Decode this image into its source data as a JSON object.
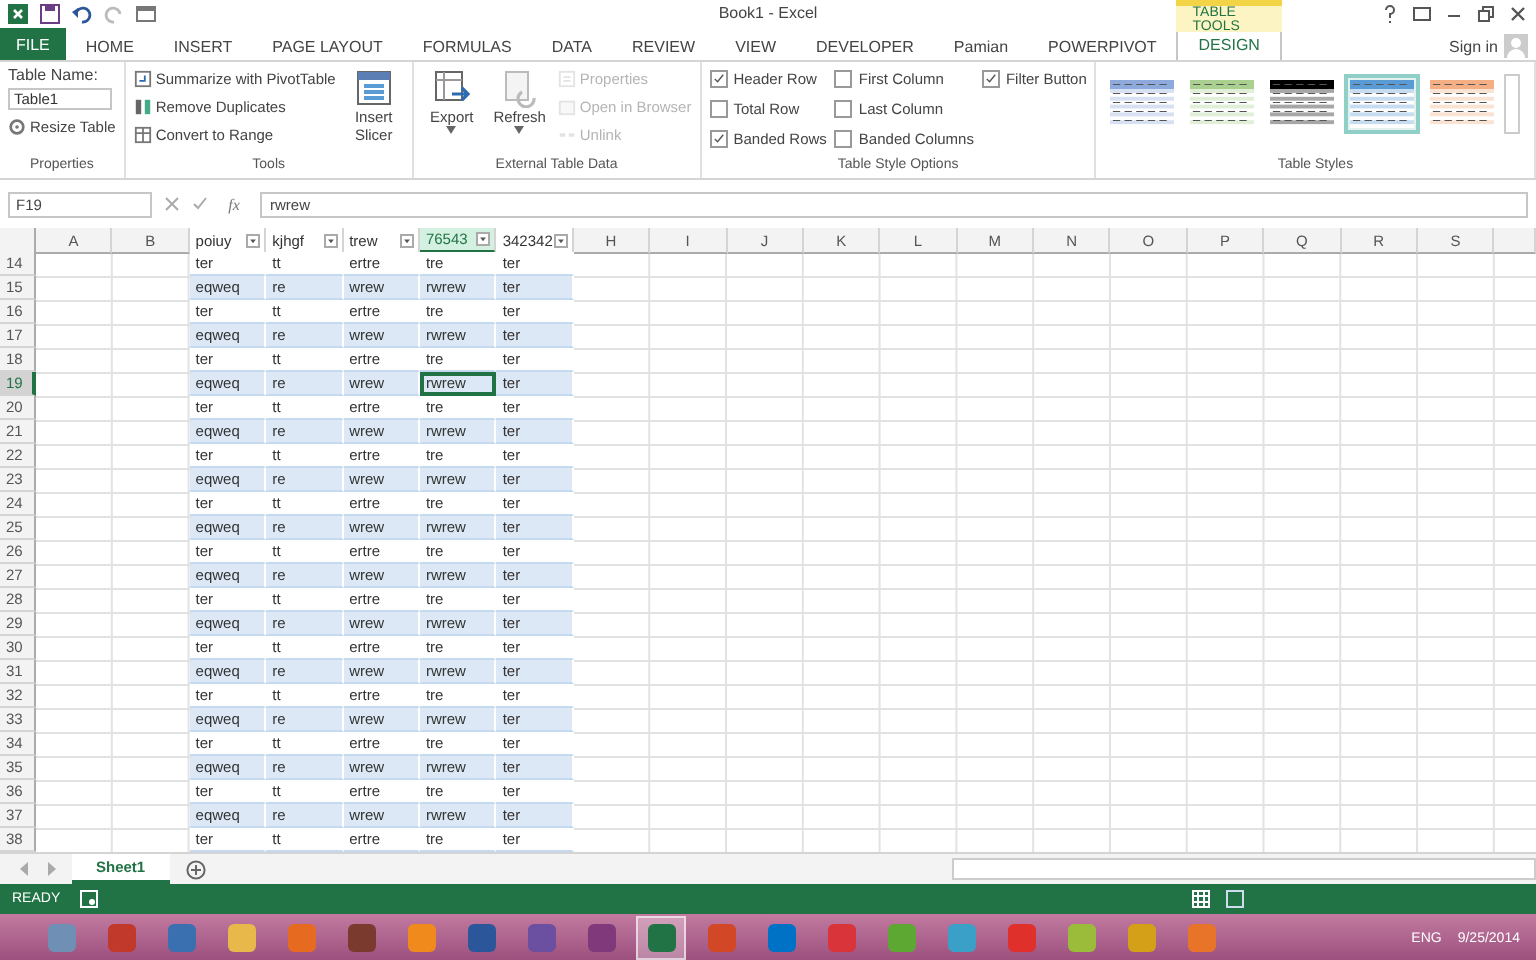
{
  "window": {
    "title": "Book1 - Excel"
  },
  "contextual_tab": {
    "label": "TABLE TOOLS"
  },
  "tabs": [
    {
      "label": "FILE",
      "kind": "file",
      "selected": false
    },
    {
      "label": "HOME",
      "kind": "tab",
      "selected": false
    },
    {
      "label": "INSERT",
      "kind": "tab",
      "selected": false
    },
    {
      "label": "PAGE LAYOUT",
      "kind": "tab",
      "selected": false
    },
    {
      "label": "FORMULAS",
      "kind": "tab",
      "selected": false
    },
    {
      "label": "DATA",
      "kind": "tab",
      "selected": false
    },
    {
      "label": "REVIEW",
      "kind": "tab",
      "selected": false
    },
    {
      "label": "VIEW",
      "kind": "tab",
      "selected": false
    },
    {
      "label": "DEVELOPER",
      "kind": "tab",
      "selected": false
    },
    {
      "label": "Pamian",
      "kind": "tab",
      "selected": false
    },
    {
      "label": "POWERPIVOT",
      "kind": "tab",
      "selected": false
    },
    {
      "label": "DESIGN",
      "kind": "tab",
      "selected": true
    }
  ],
  "account": {
    "label": "Sign in"
  },
  "ribbon_groups": [
    {
      "label": "Properties",
      "columns": [
        [
          {
            "kind": "label",
            "text": "Table Name:"
          },
          {
            "kind": "field",
            "value": "Table1"
          },
          {
            "kind": "small",
            "text": "Resize Table",
            "disabled": false
          }
        ]
      ]
    },
    {
      "label": "Tools",
      "columns": [
        [
          {
            "kind": "small",
            "text": "Summarize with PivotTable",
            "disabled": false
          },
          {
            "kind": "small",
            "text": "Remove Duplicates",
            "disabled": false
          },
          {
            "kind": "small",
            "text": "Convert to Range",
            "disabled": false
          }
        ],
        [
          {
            "kind": "large",
            "text": "Insert Slicer",
            "disabled": false,
            "has_menu": false
          }
        ]
      ]
    },
    {
      "label": "External Table Data",
      "columns": [
        [
          {
            "kind": "large",
            "text": "Export",
            "disabled": false,
            "has_menu": true
          }
        ],
        [
          {
            "kind": "large",
            "text": "Refresh",
            "disabled": false,
            "has_menu": true
          }
        ],
        [
          {
            "kind": "small",
            "text": "Properties",
            "disabled": true
          },
          {
            "kind": "small",
            "text": "Open in Browser",
            "disabled": true
          },
          {
            "kind": "small",
            "text": "Unlink",
            "disabled": true
          }
        ]
      ]
    },
    {
      "label": "Table Style Options",
      "columns": [
        [
          {
            "kind": "checkbox",
            "text": "Header Row",
            "checked": true
          },
          {
            "kind": "checkbox",
            "text": "Total Row",
            "checked": false
          },
          {
            "kind": "checkbox",
            "text": "Banded Rows",
            "checked": true
          }
        ],
        [
          {
            "kind": "checkbox",
            "text": "First Column",
            "checked": false
          },
          {
            "kind": "checkbox",
            "text": "Last Column",
            "checked": false
          },
          {
            "kind": "checkbox",
            "text": "Banded Columns",
            "checked": false
          }
        ],
        [
          {
            "kind": "checkbox",
            "text": "Filter Button",
            "checked": true
          }
        ]
      ]
    },
    {
      "label": "Table Styles",
      "columns": [
        [
          {
            "kind": "swatch",
            "color": "#8ea9db",
            "selected": false
          }
        ],
        [
          {
            "kind": "swatch",
            "color": "#a9d08e",
            "selected": false
          }
        ],
        [
          {
            "kind": "swatch",
            "color": "#000000",
            "selected": false
          }
        ],
        [
          {
            "kind": "swatch",
            "color": "#5b9bd5",
            "selected": true
          }
        ],
        [
          {
            "kind": "swatch",
            "color": "#f4b084",
            "selected": false
          }
        ]
      ]
    }
  ],
  "formula_bar": {
    "name_box": "F19",
    "function_label": "fx",
    "formula": "rwrew"
  },
  "columns": [
    {
      "label": "A",
      "kind": "letter",
      "selected": false
    },
    {
      "label": "B",
      "kind": "letter",
      "selected": false
    },
    {
      "label": "poiuy",
      "kind": "table_header",
      "selected": false
    },
    {
      "label": "kjhgf",
      "kind": "table_header",
      "selected": false
    },
    {
      "label": "trew",
      "kind": "table_header",
      "selected": false
    },
    {
      "label": "76543",
      "kind": "table_header",
      "selected": true
    },
    {
      "label": "342342",
      "kind": "table_header",
      "selected": false
    },
    {
      "label": "H",
      "kind": "letter",
      "selected": false
    },
    {
      "label": "I",
      "kind": "letter",
      "selected": false
    },
    {
      "label": "J",
      "kind": "letter",
      "selected": false
    },
    {
      "label": "K",
      "kind": "letter",
      "selected": false
    },
    {
      "label": "L",
      "kind": "letter",
      "selected": false
    },
    {
      "label": "M",
      "kind": "letter",
      "selected": false
    },
    {
      "label": "N",
      "kind": "letter",
      "selected": false
    },
    {
      "label": "O",
      "kind": "letter",
      "selected": false
    },
    {
      "label": "P",
      "kind": "letter",
      "selected": false
    },
    {
      "label": "Q",
      "kind": "letter",
      "selected": false
    },
    {
      "label": "R",
      "kind": "letter",
      "selected": false
    },
    {
      "label": "S",
      "kind": "letter",
      "selected": false
    }
  ],
  "rows": [
    {
      "number": "14",
      "banded": false,
      "selected": false,
      "cells": [
        "ter",
        "tt",
        "ertre",
        "tre",
        "ter"
      ]
    },
    {
      "number": "15",
      "banded": true,
      "selected": false,
      "cells": [
        "eqweq",
        "re",
        "wrew",
        "rwrew",
        "ter"
      ]
    },
    {
      "number": "16",
      "banded": false,
      "selected": false,
      "cells": [
        "ter",
        "tt",
        "ertre",
        "tre",
        "ter"
      ]
    },
    {
      "number": "17",
      "banded": true,
      "selected": false,
      "cells": [
        "eqweq",
        "re",
        "wrew",
        "rwrew",
        "ter"
      ]
    },
    {
      "number": "18",
      "banded": false,
      "selected": false,
      "cells": [
        "ter",
        "tt",
        "ertre",
        "tre",
        "ter"
      ]
    },
    {
      "number": "19",
      "banded": true,
      "selected": true,
      "cells": [
        "eqweq",
        "re",
        "wrew",
        "rwrew",
        "ter"
      ]
    },
    {
      "number": "20",
      "banded": false,
      "selected": false,
      "cells": [
        "ter",
        "tt",
        "ertre",
        "tre",
        "ter"
      ]
    },
    {
      "number": "21",
      "banded": true,
      "selected": false,
      "cells": [
        "eqweq",
        "re",
        "wrew",
        "rwrew",
        "ter"
      ]
    },
    {
      "number": "22",
      "banded": false,
      "selected": false,
      "cells": [
        "ter",
        "tt",
        "ertre",
        "tre",
        "ter"
      ]
    },
    {
      "number": "23",
      "banded": true,
      "selected": false,
      "cells": [
        "eqweq",
        "re",
        "wrew",
        "rwrew",
        "ter"
      ]
    },
    {
      "number": "24",
      "banded": false,
      "selected": false,
      "cells": [
        "ter",
        "tt",
        "ertre",
        "tre",
        "ter"
      ]
    },
    {
      "number": "25",
      "banded": true,
      "selected": false,
      "cells": [
        "eqweq",
        "re",
        "wrew",
        "rwrew",
        "ter"
      ]
    },
    {
      "number": "26",
      "banded": false,
      "selected": false,
      "cells": [
        "ter",
        "tt",
        "ertre",
        "tre",
        "ter"
      ]
    },
    {
      "number": "27",
      "banded": true,
      "selected": false,
      "cells": [
        "eqweq",
        "re",
        "wrew",
        "rwrew",
        "ter"
      ]
    },
    {
      "number": "28",
      "banded": false,
      "selected": false,
      "cells": [
        "ter",
        "tt",
        "ertre",
        "tre",
        "ter"
      ]
    },
    {
      "number": "29",
      "banded": true,
      "selected": false,
      "cells": [
        "eqweq",
        "re",
        "wrew",
        "rwrew",
        "ter"
      ]
    },
    {
      "number": "30",
      "banded": false,
      "selected": false,
      "cells": [
        "ter",
        "tt",
        "ertre",
        "tre",
        "ter"
      ]
    },
    {
      "number": "31",
      "banded": true,
      "selected": false,
      "cells": [
        "eqweq",
        "re",
        "wrew",
        "rwrew",
        "ter"
      ]
    },
    {
      "number": "32",
      "banded": false,
      "selected": false,
      "cells": [
        "ter",
        "tt",
        "ertre",
        "tre",
        "ter"
      ]
    },
    {
      "number": "33",
      "banded": true,
      "selected": false,
      "cells": [
        "eqweq",
        "re",
        "wrew",
        "rwrew",
        "ter"
      ]
    },
    {
      "number": "34",
      "banded": false,
      "selected": false,
      "cells": [
        "ter",
        "tt",
        "ertre",
        "tre",
        "ter"
      ]
    },
    {
      "number": "35",
      "banded": true,
      "selected": false,
      "cells": [
        "eqweq",
        "re",
        "wrew",
        "rwrew",
        "ter"
      ]
    },
    {
      "number": "36",
      "banded": false,
      "selected": false,
      "cells": [
        "ter",
        "tt",
        "ertre",
        "tre",
        "ter"
      ]
    },
    {
      "number": "37",
      "banded": true,
      "selected": false,
      "cells": [
        "eqweq",
        "re",
        "wrew",
        "rwrew",
        "ter"
      ]
    },
    {
      "number": "38",
      "banded": false,
      "selected": false,
      "cells": [
        "ter",
        "tt",
        "ertre",
        "tre",
        "ter"
      ]
    }
  ],
  "sheet_tabs": [
    {
      "label": "Sheet1",
      "selected": true
    }
  ],
  "status_bar": {
    "mode": "READY"
  },
  "taskbar": {
    "apps": [
      {
        "color": "#6f8fb5",
        "selected": false
      },
      {
        "color": "#c0392b",
        "selected": false
      },
      {
        "color": "#3a6fb0",
        "selected": false
      },
      {
        "color": "#e8b84a",
        "selected": false
      },
      {
        "color": "#e66a1f",
        "selected": false
      },
      {
        "color": "#7a3b2e",
        "selected": false
      },
      {
        "color": "#f08a1c",
        "selected": false
      },
      {
        "color": "#2b579a",
        "selected": false
      },
      {
        "color": "#6b4fa0",
        "selected": false
      },
      {
        "color": "#80397b",
        "selected": false
      },
      {
        "color": "#217346",
        "selected": true
      },
      {
        "color": "#d24726",
        "selected": false
      },
      {
        "color": "#0072c6",
        "selected": false
      },
      {
        "color": "#d8343a",
        "selected": false
      },
      {
        "color": "#5ca832",
        "selected": false
      },
      {
        "color": "#3aa0c8",
        "selected": false
      },
      {
        "color": "#e0302c",
        "selected": false
      },
      {
        "color": "#9bbb3a",
        "selected": false
      },
      {
        "color": "#d4a017",
        "selected": false
      },
      {
        "color": "#e8742a",
        "selected": false
      }
    ],
    "language": "ENG",
    "date": "9/25/2014"
  }
}
